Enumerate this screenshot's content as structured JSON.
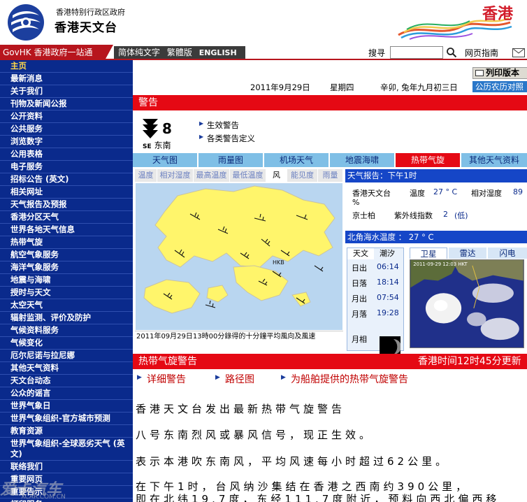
{
  "header": {
    "org_sub": "香港特别行政区政府",
    "org_main": "香港天文台",
    "brand_text": "香港"
  },
  "topbar": {
    "govhk": "GovHK 香港政府一站通",
    "lang_simplified": "简体纯文字",
    "lang_traditional": "繁體版",
    "lang_english": "ENGLISH",
    "search_label": "搜寻",
    "search_placeholder": "",
    "sitemap": "网页指南"
  },
  "sidebar": {
    "items": [
      {
        "label": "主页"
      },
      {
        "label": "最新消息"
      },
      {
        "label": "关于我们"
      },
      {
        "label": "刊物及新闻公报"
      },
      {
        "label": "公开资料"
      },
      {
        "label": "公共服务"
      },
      {
        "label": "浏览数字"
      },
      {
        "label": "公用表格"
      },
      {
        "label": "电子服务"
      },
      {
        "label": "招标公告 (英文)"
      },
      {
        "label": "相关网址"
      },
      {
        "label": "天气报告及预报"
      },
      {
        "label": "香港分区天气"
      },
      {
        "label": "世界各地天气信息"
      },
      {
        "label": "热带气旋"
      },
      {
        "label": "航空气象服务"
      },
      {
        "label": "海洋气象服务"
      },
      {
        "label": "地震与海啸"
      },
      {
        "label": "授时与天文"
      },
      {
        "label": "太空天气"
      },
      {
        "label": "辐射监测、评价及防护"
      },
      {
        "label": "气候资料服务"
      },
      {
        "label": "气候变化"
      },
      {
        "label": "厄尔尼诺与拉尼娜"
      },
      {
        "label": "其他天气资料"
      },
      {
        "label": "天文台动态"
      },
      {
        "label": "公众的谣言"
      },
      {
        "label": "世界气象日"
      },
      {
        "label": "世界气象组织-官方城市预测"
      },
      {
        "label": "教育资源"
      },
      {
        "label": "世界气象组织-全球恶劣天气 (英文)"
      },
      {
        "label": "联络我们"
      },
      {
        "label": "重要网页"
      },
      {
        "label": "重要告示"
      },
      {
        "label": "打印服务"
      }
    ]
  },
  "toolbar": {
    "print": "列印版本",
    "calendar": "公历农历对照"
  },
  "date_row": {
    "date": "2011年9月29日",
    "weekday": "星期四",
    "lunar": "辛卯, 兔年九月初三日"
  },
  "warning": {
    "bar_title": "警告",
    "signal_number": "8",
    "signal_dir_code": "SE",
    "signal_dir_label": "东南",
    "links": [
      "生效警告",
      "各类警告定义"
    ]
  },
  "tabs": [
    "天气图",
    "雨量图",
    "机场天气",
    "地震海啸",
    "热带气旋",
    "其他天气资料"
  ],
  "subtabs": [
    "温度",
    "相对湿度",
    "最高温度",
    "最低温度",
    "风",
    "能见度",
    "雨量"
  ],
  "map": {
    "caption": "2011年09月29日13時00分錄得的十分鐘平均風向及風速",
    "label_hkb": "HKB"
  },
  "report": {
    "head": "天气报告：下午1时",
    "station": "香港天文台",
    "temp_label": "温度",
    "temp_value": "27 ° C",
    "humidity_label": "相对湿度",
    "humidity_value": "89",
    "humidity_unit": "%",
    "uv_station": "京士柏",
    "uv_label": "紫外线指数",
    "uv_value": "2",
    "uv_level": "(低)",
    "sea_head": "北角海水温度 ： 27 ° C"
  },
  "sun": {
    "tab_astro": "天文",
    "tab_tide": "潮汐",
    "rows": [
      {
        "label": "日出",
        "value": "06:14"
      },
      {
        "label": "日落",
        "value": "18:14"
      },
      {
        "label": "月出",
        "value": "07:54"
      },
      {
        "label": "月落",
        "value": "19:28"
      }
    ],
    "moon_label": "月相"
  },
  "satellite": {
    "tabs": [
      "卫星",
      "雷达",
      "闪电"
    ],
    "stamp": "2011-09-29 12:03 HKT"
  },
  "cyclone": {
    "title": "热带气旋警告",
    "time": "香港时间12时45分更新",
    "links": [
      "详细警告",
      "路径图",
      "为船舶提供的热带气旋警告"
    ],
    "paragraphs": [
      "香港天文台发出最新热带气旋警告",
      "八号东南烈风或暴风信号，现正生效。",
      "表示本港吹东南风，平均风速每小时超过62公里。",
      "在下午1时，台风纳沙集结在香港之西南约390公里，",
      "即在北纬19.7度，东经111.7度附近，预料向西北偏西移"
    ]
  },
  "watermark": {
    "text": "爱卡汽车",
    "sub": "XCAR.COM.CN"
  },
  "colors": {
    "nav_blue": "#0a2a8c",
    "alert_red": "#e50914",
    "tab_blue": "#7fbfe6",
    "head_blue": "#1546c7"
  }
}
